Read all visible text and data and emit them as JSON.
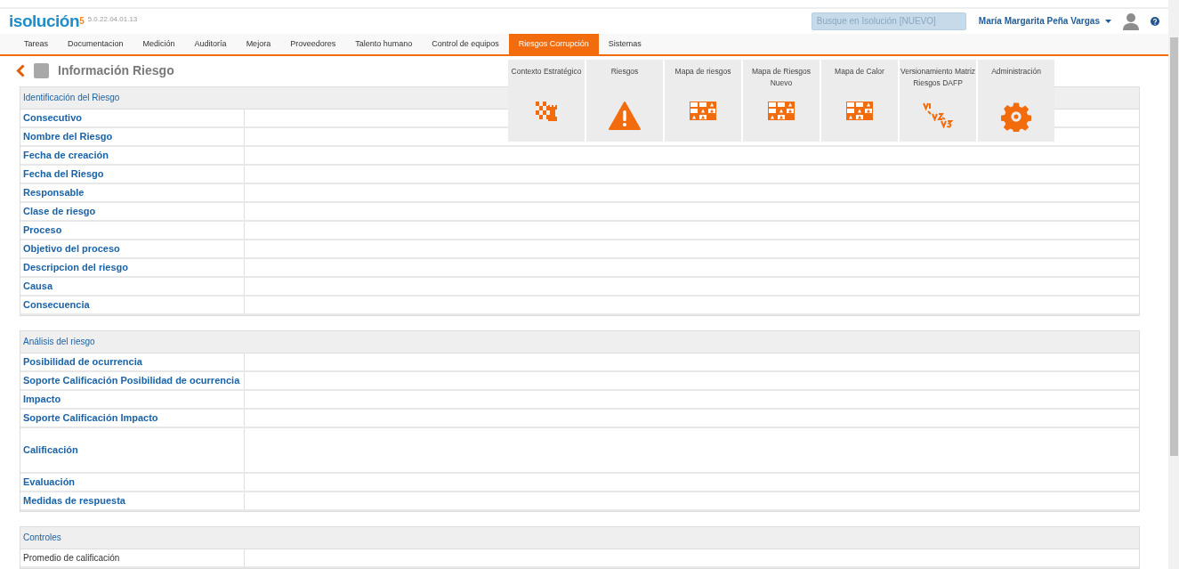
{
  "header": {
    "logo": "isolución",
    "logo_sup": "5",
    "version": "5.0.22.04.01.13",
    "search": {
      "placeholder": "Busque en Isolución [NUEVO]"
    },
    "user": "María Margarita Peña Vargas"
  },
  "tabs": [
    {
      "label": "Tareas",
      "selected": false
    },
    {
      "label": "Documentacion",
      "selected": false
    },
    {
      "label": "Medición",
      "selected": false
    },
    {
      "label": "Auditoría",
      "selected": false
    },
    {
      "label": "Mejora",
      "selected": false
    },
    {
      "label": "Proveedores",
      "selected": false
    },
    {
      "label": "Talento humano",
      "selected": false
    },
    {
      "label": "Control de equipos",
      "selected": false
    },
    {
      "label": "Riesgos Corrupción",
      "selected": true
    },
    {
      "label": "Sistemas",
      "selected": false
    }
  ],
  "menu": [
    {
      "label": "Contexto Estratégico",
      "kind": "chess"
    },
    {
      "label": "Riesgos",
      "kind": "warning"
    },
    {
      "label": "Mapa de riesgos",
      "kind": "map"
    },
    {
      "label": "Mapa de Riesgos Nuevo",
      "kind": "map"
    },
    {
      "label": "Mapa de Calor",
      "kind": "map"
    },
    {
      "label": "Versionamiento Matriz Riesgos DAFP",
      "kind": "versions"
    },
    {
      "label": "Administración",
      "kind": "gear"
    }
  ],
  "page_title": "Información Riesgo",
  "sections": [
    {
      "title": "Identificación del Riesgo",
      "rows": [
        {
          "label": "Consecutivo",
          "kind": "field"
        },
        {
          "label": "Nombre del Riesgo",
          "kind": "field"
        },
        {
          "label": "Fecha de creación",
          "kind": "field"
        },
        {
          "label": "Fecha del Riesgo",
          "kind": "field"
        },
        {
          "label": "Responsable",
          "kind": "field"
        },
        {
          "label": "Clase de riesgo",
          "kind": "field"
        },
        {
          "label": "Proceso",
          "kind": "field"
        },
        {
          "label": "Objetivo del proceso",
          "kind": "field"
        },
        {
          "label": "Descripcion del riesgo",
          "kind": "field"
        },
        {
          "label": "Causa",
          "kind": "field"
        },
        {
          "label": "Consecuencia",
          "kind": "field"
        }
      ]
    },
    {
      "title": "Análisis del riesgo",
      "rows": [
        {
          "label": "Posibilidad de ocurrencia",
          "kind": "field"
        },
        {
          "label": "Soporte Calificación Posibilidad de ocurrencia",
          "kind": "field"
        },
        {
          "label": "Impacto",
          "kind": "field"
        },
        {
          "label": "Soporte Calificación Impacto",
          "kind": "field"
        },
        {
          "label": "Calificación",
          "kind": "tall"
        },
        {
          "label": "Evaluación",
          "kind": "field"
        },
        {
          "label": "Medidas de respuesta",
          "kind": "field"
        }
      ]
    },
    {
      "title": "Controles",
      "rows": [
        {
          "label": "Promedio de calificación",
          "kind": "plain"
        }
      ]
    }
  ]
}
